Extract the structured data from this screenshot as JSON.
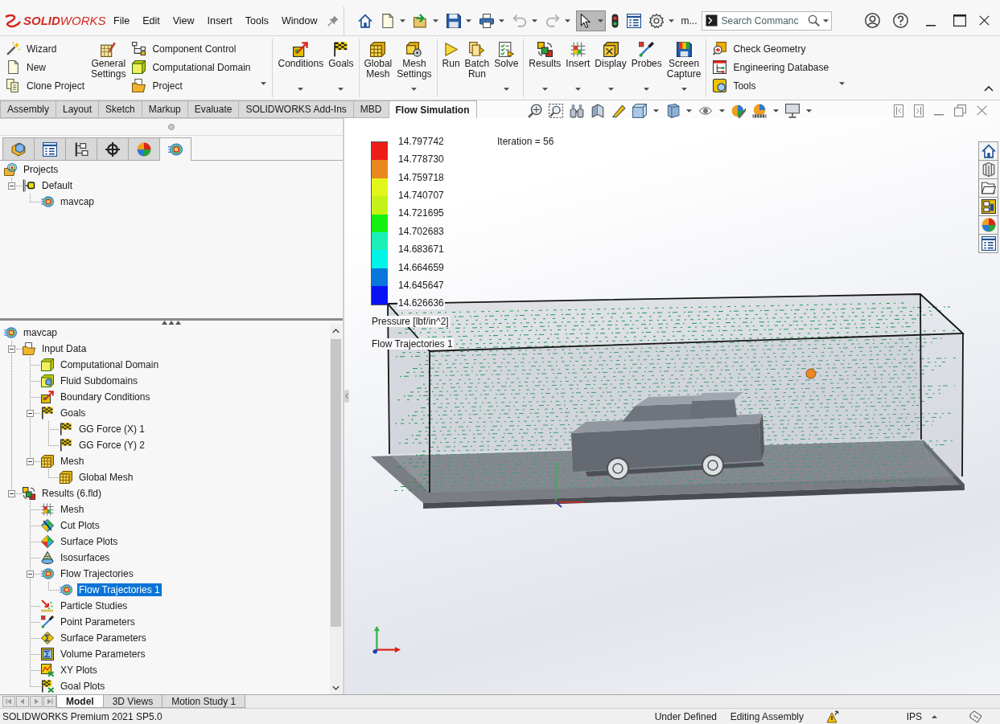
{
  "titlebar": {
    "logo": "**SOLID**WORKS",
    "menus": [
      {
        "label": "File"
      },
      {
        "label": "Edit"
      },
      {
        "label": "View"
      },
      {
        "label": "Insert"
      },
      {
        "label": "Tools"
      },
      {
        "label": "Window"
      }
    ],
    "quick_access": [
      {
        "pressed": false,
        "disabled": false
      },
      {
        "pressed": false,
        "disabled": false
      },
      {
        "pressed": false,
        "disabled": false
      },
      {
        "pressed": false,
        "disabled": false
      },
      {
        "pressed": false,
        "disabled": false
      },
      {
        "pressed": false,
        "disabled": true
      },
      {
        "pressed": false,
        "disabled": true
      },
      {
        "pressed": true,
        "disabled": false
      },
      {
        "pressed": false,
        "disabled": false
      },
      {
        "pressed": false,
        "disabled": false
      },
      {
        "pressed": false,
        "disabled": false
      }
    ],
    "title": "m...",
    "search": {
      "placeholder": "Search Commanc"
    }
  },
  "ribbon": {
    "groups": [
      {
        "menu": true,
        "items": [
          {
            "kind": "stack",
            "items": [
              {
                "label": "Wizard"
              },
              {
                "label": "New"
              },
              {
                "label": "Clone Project"
              }
            ]
          },
          {
            "kind": "large",
            "label": "General Settings",
            "menu": false
          },
          {
            "kind": "stack",
            "items": [
              {
                "label": "Component Control"
              },
              {
                "label": "Computational Domain"
              },
              {
                "label": "Project"
              }
            ]
          }
        ]
      },
      {
        "menu": false,
        "items": [
          {
            "kind": "large",
            "label": "Conditions",
            "menu": true
          },
          {
            "kind": "large",
            "label": "Goals",
            "menu": true
          }
        ]
      },
      {
        "menu": false,
        "items": [
          {
            "kind": "large",
            "label": "Global Mesh",
            "menu": false
          },
          {
            "kind": "large",
            "label": "Mesh Settings",
            "menu": true
          }
        ]
      },
      {
        "menu": false,
        "items": [
          {
            "kind": "large",
            "label": "Run",
            "menu": false
          },
          {
            "kind": "large",
            "label": "Batch Run",
            "menu": false
          },
          {
            "kind": "large",
            "label": "Solve",
            "menu": true
          }
        ]
      },
      {
        "menu": false,
        "items": [
          {
            "kind": "large",
            "label": "Results",
            "menu": true
          },
          {
            "kind": "large",
            "label": "Insert",
            "menu": true
          },
          {
            "kind": "large",
            "label": "Display",
            "menu": true
          },
          {
            "kind": "large",
            "label": "Probes",
            "menu": true
          },
          {
            "kind": "large",
            "label": "Screen Capture",
            "menu": true
          }
        ]
      },
      {
        "menu": true,
        "items": [
          {
            "kind": "stack",
            "items": [
              {
                "label": "Check Geometry"
              },
              {
                "label": "Engineering Database"
              },
              {
                "label": "Tools"
              }
            ]
          }
        ]
      }
    ]
  },
  "tabs": [
    {
      "label": "Assembly",
      "selected": false
    },
    {
      "label": "Layout",
      "selected": false
    },
    {
      "label": "Sketch",
      "selected": false
    },
    {
      "label": "Markup",
      "selected": false
    },
    {
      "label": "Evaluate",
      "selected": false
    },
    {
      "label": "SOLIDWORKS Add-Ins",
      "selected": false
    },
    {
      "label": "MBD",
      "selected": false
    },
    {
      "label": "Flow Simulation",
      "selected": true
    }
  ],
  "manager_tabs": [
    {
      "selected": false
    },
    {
      "selected": false
    },
    {
      "selected": false
    },
    {
      "selected": false
    },
    {
      "selected": false
    },
    {
      "selected": true
    }
  ],
  "project_tree": [
    {
      "label": "Projects",
      "selected": false,
      "children": [
        {
          "label": "Default",
          "expanded": true,
          "selected": false,
          "children": [
            {
              "label": "mavcap",
              "selected": false
            }
          ]
        }
      ]
    }
  ],
  "analysis_tree": [
    {
      "label": "mavcap",
      "selected": false,
      "children": [
        {
          "label": "Input Data",
          "expanded": true,
          "selected": false,
          "children": [
            {
              "label": "Computational Domain",
              "selected": false
            },
            {
              "label": "Fluid Subdomains",
              "selected": false
            },
            {
              "label": "Boundary Conditions",
              "selected": false
            },
            {
              "label": "Goals",
              "expanded": true,
              "selected": false,
              "children": [
                {
                  "label": "GG Force (X) 1",
                  "selected": false
                },
                {
                  "label": "GG Force (Y) 2",
                  "selected": false
                }
              ]
            },
            {
              "label": "Mesh",
              "expanded": true,
              "selected": false,
              "children": [
                {
                  "label": "Global Mesh",
                  "selected": false
                }
              ]
            }
          ]
        },
        {
          "label": "Results (6.fld)",
          "expanded": true,
          "selected": false,
          "children": [
            {
              "label": "Mesh",
              "selected": false
            },
            {
              "label": "Cut Plots",
              "selected": false
            },
            {
              "label": "Surface Plots",
              "selected": false
            },
            {
              "label": "Isosurfaces",
              "selected": false
            },
            {
              "label": "Flow Trajectories",
              "expanded": true,
              "selected": false,
              "children": [
                {
                  "label": "Flow Trajectories 1",
                  "selected": true
                }
              ]
            },
            {
              "label": "Particle Studies",
              "selected": false
            },
            {
              "label": "Point Parameters",
              "selected": false
            },
            {
              "label": "Surface Parameters",
              "selected": false
            },
            {
              "label": "Volume Parameters",
              "selected": false
            },
            {
              "label": "XY Plots",
              "selected": false
            },
            {
              "label": "Goal Plots",
              "selected": false
            }
          ]
        }
      ]
    }
  ],
  "viewport": {
    "iteration": "Iteration = 56",
    "legend": {
      "bands": [
        {
          "color": "#ee1c16"
        },
        {
          "color": "#ea881e"
        },
        {
          "color": "#e2f61a"
        },
        {
          "color": "#c4f218"
        },
        {
          "color": "#14f010"
        },
        {
          "color": "#1cf0b8"
        },
        {
          "color": "#00f4e8"
        },
        {
          "color": "#0a76dc"
        },
        {
          "color": "#0a12f4"
        }
      ],
      "labels": [
        "14.797742",
        "14.778730",
        "14.759718",
        "14.740707",
        "14.721695",
        "14.702683",
        "14.683671",
        "14.664659",
        "14.645647",
        "14.626636"
      ],
      "quantity": "Pressure [lbf/in^2]",
      "plot_name": "Flow Trajectories 1"
    }
  },
  "model_tabs": [
    {
      "label": "Model",
      "selected": true
    },
    {
      "label": "3D Views",
      "selected": false
    },
    {
      "label": "Motion Study 1",
      "selected": false
    }
  ],
  "status_bar": {
    "product": "SOLIDWORKS Premium 2021 SP5.0",
    "state": "Under Defined",
    "mode": "Editing Assembly",
    "units": "IPS"
  }
}
